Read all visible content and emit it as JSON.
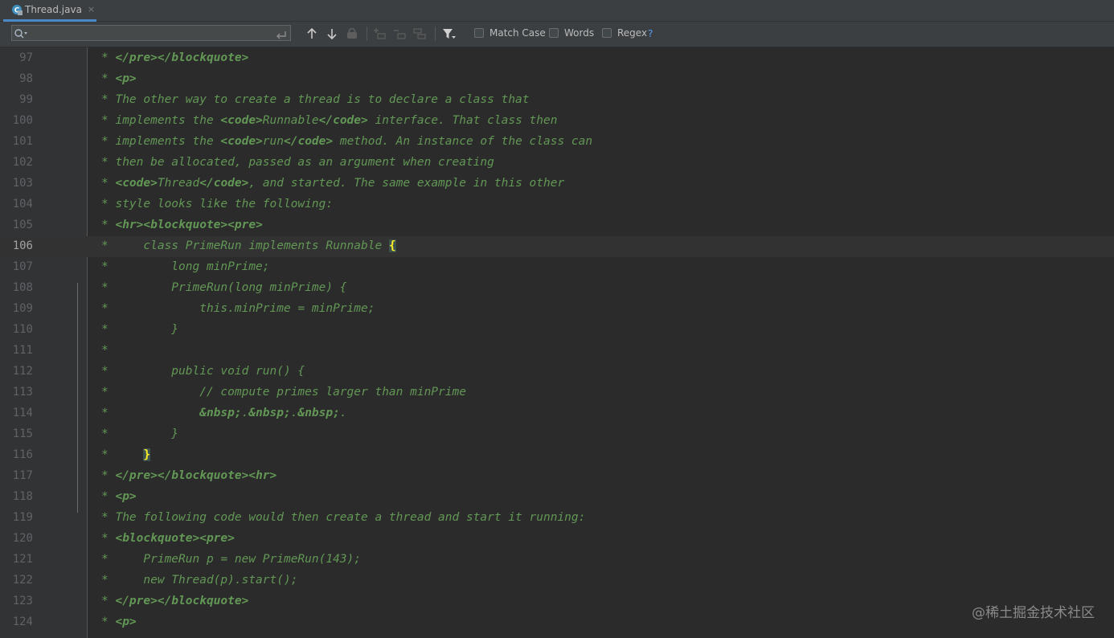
{
  "tab": {
    "filename": "Thread.java",
    "close": "×"
  },
  "search": {
    "value": "",
    "placeholder": "",
    "match_case": "Match Case",
    "words": "Words",
    "regex": "Regex",
    "help": "?"
  },
  "editor": {
    "current_line": "106",
    "lines": [
      {
        "num": "97",
        "segs": [
          {
            "t": "* "
          },
          {
            "t": "</pre></blockquote>",
            "b": 1
          }
        ]
      },
      {
        "num": "98",
        "segs": [
          {
            "t": "* "
          },
          {
            "t": "<p>",
            "b": 1
          }
        ]
      },
      {
        "num": "99",
        "segs": [
          {
            "t": "* The other way to create a thread is to declare a class that"
          }
        ]
      },
      {
        "num": "100",
        "segs": [
          {
            "t": "* implements the "
          },
          {
            "t": "<code>",
            "b": 1
          },
          {
            "t": "Runnable"
          },
          {
            "t": "</code>",
            "b": 1
          },
          {
            "t": " interface. That class then"
          }
        ]
      },
      {
        "num": "101",
        "segs": [
          {
            "t": "* implements the "
          },
          {
            "t": "<code>",
            "b": 1
          },
          {
            "t": "run"
          },
          {
            "t": "</code>",
            "b": 1
          },
          {
            "t": " method. An instance of the class can"
          }
        ]
      },
      {
        "num": "102",
        "segs": [
          {
            "t": "* then be allocated, passed as an argument when creating"
          }
        ]
      },
      {
        "num": "103",
        "segs": [
          {
            "t": "* "
          },
          {
            "t": "<code>",
            "b": 1
          },
          {
            "t": "Thread"
          },
          {
            "t": "</code>",
            "b": 1
          },
          {
            "t": ", and started. The same example in this other"
          }
        ]
      },
      {
        "num": "104",
        "segs": [
          {
            "t": "* style looks like the following:"
          }
        ]
      },
      {
        "num": "105",
        "segs": [
          {
            "t": "* "
          },
          {
            "t": "<hr><blockquote><pre>",
            "b": 1
          }
        ]
      },
      {
        "num": "106",
        "segs": [
          {
            "t": "*     class PrimeRun implements Runnable "
          },
          {
            "t": "{",
            "br": 1
          }
        ]
      },
      {
        "num": "107",
        "segs": [
          {
            "t": "*         long minPrime;"
          }
        ]
      },
      {
        "num": "108",
        "segs": [
          {
            "t": "*         PrimeRun(long minPrime) {"
          }
        ]
      },
      {
        "num": "109",
        "segs": [
          {
            "t": "*             this.minPrime = minPrime;"
          }
        ]
      },
      {
        "num": "110",
        "segs": [
          {
            "t": "*         }"
          }
        ]
      },
      {
        "num": "111",
        "segs": [
          {
            "t": "*"
          }
        ]
      },
      {
        "num": "112",
        "segs": [
          {
            "t": "*         public void run() {"
          }
        ]
      },
      {
        "num": "113",
        "segs": [
          {
            "t": "*             // compute primes larger than minPrime"
          }
        ]
      },
      {
        "num": "114",
        "segs": [
          {
            "t": "*             "
          },
          {
            "t": "&nbsp;",
            "b": 1
          },
          {
            "t": "."
          },
          {
            "t": "&nbsp;",
            "b": 1
          },
          {
            "t": "."
          },
          {
            "t": "&nbsp;",
            "b": 1
          },
          {
            "t": "."
          }
        ]
      },
      {
        "num": "115",
        "segs": [
          {
            "t": "*         }"
          }
        ]
      },
      {
        "num": "116",
        "segs": [
          {
            "t": "*     "
          },
          {
            "t": "}",
            "br": 1
          }
        ]
      },
      {
        "num": "117",
        "segs": [
          {
            "t": "* "
          },
          {
            "t": "</pre></blockquote><hr>",
            "b": 1
          }
        ]
      },
      {
        "num": "118",
        "segs": [
          {
            "t": "* "
          },
          {
            "t": "<p>",
            "b": 1
          }
        ]
      },
      {
        "num": "119",
        "segs": [
          {
            "t": "* The following code would then create a thread and start it running:"
          }
        ]
      },
      {
        "num": "120",
        "segs": [
          {
            "t": "* "
          },
          {
            "t": "<blockquote><pre>",
            "b": 1
          }
        ]
      },
      {
        "num": "121",
        "segs": [
          {
            "t": "*     PrimeRun p = new PrimeRun(143);"
          }
        ]
      },
      {
        "num": "122",
        "segs": [
          {
            "t": "*     new Thread(p).start();"
          }
        ]
      },
      {
        "num": "123",
        "segs": [
          {
            "t": "* "
          },
          {
            "t": "</pre></blockquote>",
            "b": 1
          }
        ]
      },
      {
        "num": "124",
        "segs": [
          {
            "t": "* "
          },
          {
            "t": "<p>",
            "b": 1
          }
        ]
      }
    ]
  },
  "watermark": "@稀土掘金技术社区",
  "colors": {
    "comment": "#629755",
    "background": "#2b2b2b",
    "gutter": "#313335",
    "line_number": "#606366",
    "brace_highlight": "#ffef28"
  }
}
